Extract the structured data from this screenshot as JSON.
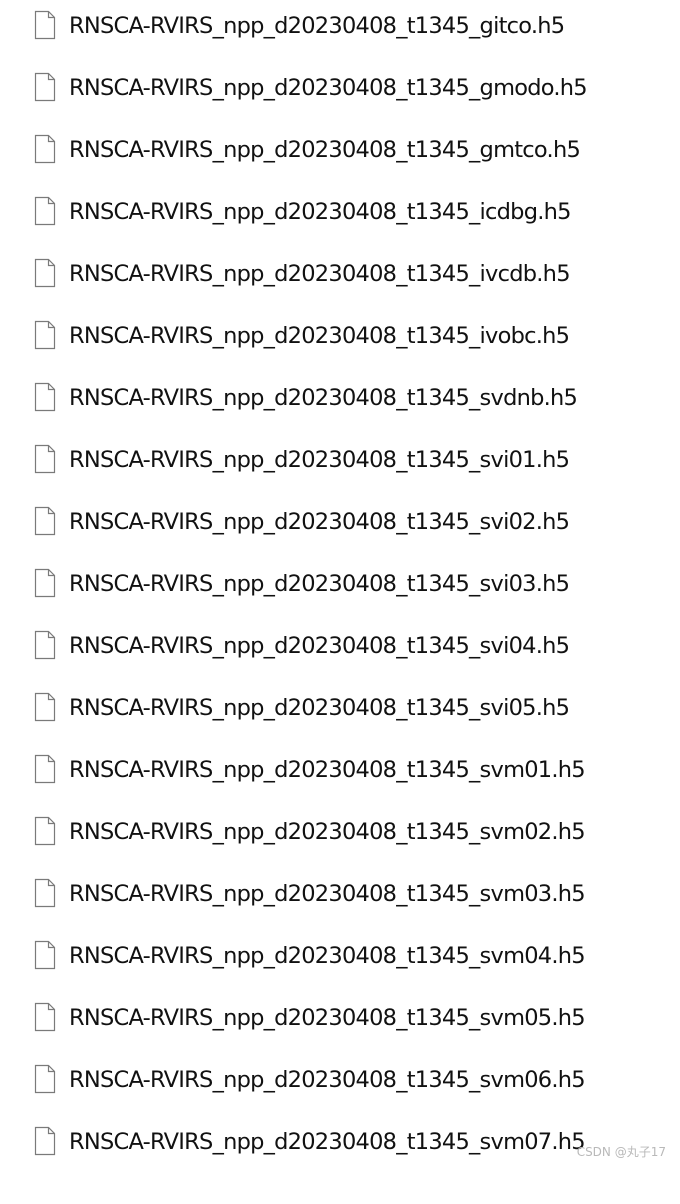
{
  "files": [
    {
      "name": "RNSCA-RVIRS_npp_d20230408_t1345_gitco.h5",
      "icon": "document-icon"
    },
    {
      "name": "RNSCA-RVIRS_npp_d20230408_t1345_gmodo.h5",
      "icon": "document-icon"
    },
    {
      "name": "RNSCA-RVIRS_npp_d20230408_t1345_gmtco.h5",
      "icon": "document-icon"
    },
    {
      "name": "RNSCA-RVIRS_npp_d20230408_t1345_icdbg.h5",
      "icon": "document-icon"
    },
    {
      "name": "RNSCA-RVIRS_npp_d20230408_t1345_ivcdb.h5",
      "icon": "document-icon"
    },
    {
      "name": "RNSCA-RVIRS_npp_d20230408_t1345_ivobc.h5",
      "icon": "document-icon"
    },
    {
      "name": "RNSCA-RVIRS_npp_d20230408_t1345_svdnb.h5",
      "icon": "document-icon"
    },
    {
      "name": "RNSCA-RVIRS_npp_d20230408_t1345_svi01.h5",
      "icon": "document-icon"
    },
    {
      "name": "RNSCA-RVIRS_npp_d20230408_t1345_svi02.h5",
      "icon": "document-icon"
    },
    {
      "name": "RNSCA-RVIRS_npp_d20230408_t1345_svi03.h5",
      "icon": "document-icon"
    },
    {
      "name": "RNSCA-RVIRS_npp_d20230408_t1345_svi04.h5",
      "icon": "document-icon"
    },
    {
      "name": "RNSCA-RVIRS_npp_d20230408_t1345_svi05.h5",
      "icon": "document-icon"
    },
    {
      "name": "RNSCA-RVIRS_npp_d20230408_t1345_svm01.h5",
      "icon": "document-icon"
    },
    {
      "name": "RNSCA-RVIRS_npp_d20230408_t1345_svm02.h5",
      "icon": "document-icon"
    },
    {
      "name": "RNSCA-RVIRS_npp_d20230408_t1345_svm03.h5",
      "icon": "document-icon"
    },
    {
      "name": "RNSCA-RVIRS_npp_d20230408_t1345_svm04.h5",
      "icon": "document-icon"
    },
    {
      "name": "RNSCA-RVIRS_npp_d20230408_t1345_svm05.h5",
      "icon": "document-icon"
    },
    {
      "name": "RNSCA-RVIRS_npp_d20230408_t1345_svm06.h5",
      "icon": "document-icon"
    },
    {
      "name": "RNSCA-RVIRS_npp_d20230408_t1345_svm07.h5",
      "icon": "document-icon"
    }
  ],
  "watermark": "CSDN @丸子17",
  "colors": {
    "text": "#111111",
    "icon_stroke": "#7a7a7a",
    "icon_fill": "#ffffff",
    "watermark": "#b9b9b9"
  }
}
